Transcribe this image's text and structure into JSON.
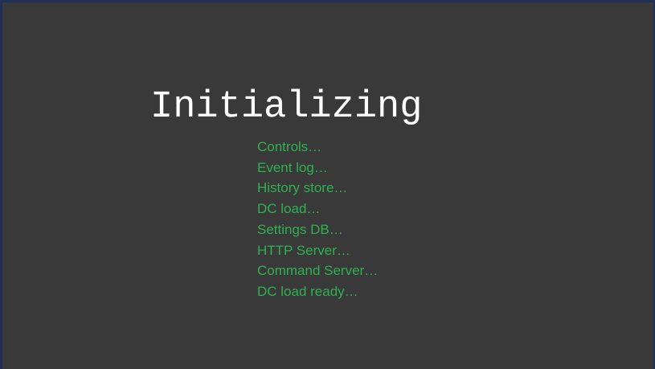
{
  "screen": {
    "title": "Initializing",
    "text_color": "#2fb050",
    "background_color": "#3a3939",
    "title_color": "#ffffff"
  },
  "steps": [
    "Controls…",
    "Event log…",
    "History store…",
    "DC load…",
    "Settings DB…",
    "HTTP Server…",
    "Command Server…",
    "DC load ready…"
  ]
}
